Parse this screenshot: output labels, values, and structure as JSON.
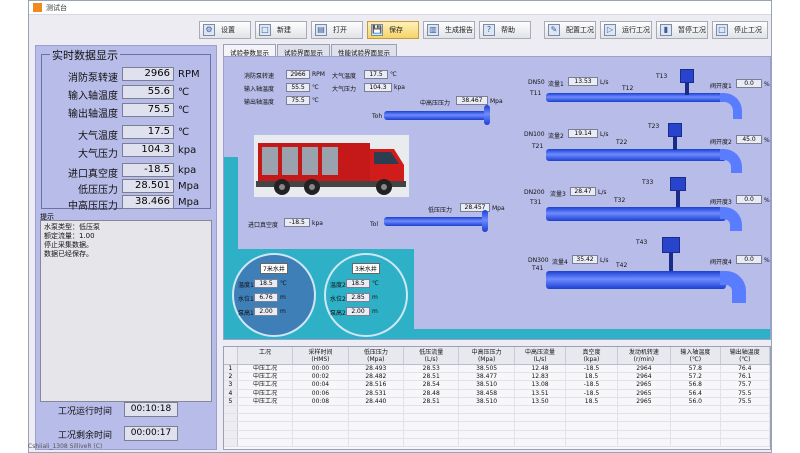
{
  "window": {
    "title": "测试台"
  },
  "toolbar": [
    {
      "id": "settings",
      "label": "设置",
      "icon": "⚙"
    },
    {
      "id": "new",
      "label": "新建",
      "icon": "□"
    },
    {
      "id": "open",
      "label": "打开",
      "icon": "▤"
    },
    {
      "id": "save",
      "label": "保存",
      "icon": "💾"
    },
    {
      "id": "report",
      "label": "生成报告",
      "icon": "▥"
    },
    {
      "id": "help",
      "label": "帮助",
      "icon": "?"
    },
    {
      "id": "config",
      "label": "配置工况",
      "icon": "✎"
    },
    {
      "id": "run",
      "label": "运行工况",
      "icon": "▷"
    },
    {
      "id": "pause",
      "label": "暂停工况",
      "icon": "▮"
    },
    {
      "id": "stop",
      "label": "停止工况",
      "icon": "□"
    }
  ],
  "left": {
    "group_title": "实时数据显示",
    "metrics": [
      {
        "label": "消防泵转速",
        "value": "2966",
        "unit": "RPM"
      },
      {
        "label": "输入轴温度",
        "value": "55.6",
        "unit": "℃"
      },
      {
        "label": "输出轴温度",
        "value": "75.5",
        "unit": "℃"
      },
      {
        "label": "大气温度",
        "value": "17.5",
        "unit": "℃"
      },
      {
        "label": "大气压力",
        "value": "104.3",
        "unit": "kpa"
      },
      {
        "label": "进口真空度",
        "value": "-18.5",
        "unit": "kpa"
      },
      {
        "label": "低压压力",
        "value": "28.501",
        "unit": "Mpa"
      },
      {
        "label": "中高压压力",
        "value": "38.466",
        "unit": "Mpa"
      }
    ],
    "tip_label": "提示",
    "tips": [
      "水泵类型：低压泵",
      "额定流量：1.00",
      "停止采集数据。",
      "数据已经保存。"
    ],
    "run_time_label": "工况运行时间",
    "run_time": "00:10:18",
    "remain_time_label": "工况剩余时间",
    "remain_time": "00:00:17"
  },
  "tabs": [
    "试验参数显示",
    "试验界面显示",
    "性能试验界面显示"
  ],
  "panel": {
    "small": [
      {
        "label": "消防泵转速",
        "value": "2966",
        "unit": "RPM"
      },
      {
        "label": "输入轴温度",
        "value": "55.5",
        "unit": "℃"
      },
      {
        "label": "输出轴温度",
        "value": "75.5",
        "unit": "℃"
      },
      {
        "label": "大气温度",
        "value": "17.5",
        "unit": "℃"
      },
      {
        "label": "大气压力",
        "value": "104.3",
        "unit": "kpa"
      }
    ],
    "mid_pressure": {
      "label": "中高压压力",
      "value": "38.467",
      "unit": "Mpa"
    },
    "low_pressure": {
      "label": "低压压力",
      "value": "28.457",
      "unit": "Mpa"
    },
    "inlet_vacuum": {
      "label": "进口真空度",
      "value": "-18.5",
      "unit": "kpa"
    },
    "toh": "Toh",
    "tol": "Tol",
    "lines": [
      {
        "dn": "DN50",
        "flow_label": "流量1",
        "flow": "13.53",
        "flow_unit": "L/s",
        "t_left": "T11",
        "t_mid": "T12",
        "t_top": "T13",
        "open_label": "阀开度1",
        "open": "0.0",
        "open_unit": "%"
      },
      {
        "dn": "DN100",
        "flow_label": "流量2",
        "flow": "19.14",
        "flow_unit": "L/s",
        "t_left": "T21",
        "t_mid": "T22",
        "t_top": "T23",
        "open_label": "阀开度2",
        "open": "45.0",
        "open_unit": "%"
      },
      {
        "dn": "DN200",
        "flow_label": "流量3",
        "flow": "28.47",
        "flow_unit": "L/s",
        "t_left": "T31",
        "t_mid": "T32",
        "t_top": "T33",
        "open_label": "阀开度3",
        "open": "0.0",
        "open_unit": "%"
      },
      {
        "dn": "DN300",
        "flow_label": "流量4",
        "flow": "35.42",
        "flow_unit": "L/s",
        "t_left": "T41",
        "t_mid": "T42",
        "t_top": "T43",
        "open_label": "阀开度4",
        "open": "0.0",
        "open_unit": "%"
      }
    ],
    "wells": [
      {
        "title": "7米水井",
        "rows": [
          {
            "label": "温度1",
            "value": "18.5",
            "unit": "℃"
          },
          {
            "label": "水位1",
            "value": "6.76",
            "unit": "m"
          },
          {
            "label": "泵高1",
            "value": "2.00",
            "unit": "m"
          }
        ]
      },
      {
        "title": "3米水井",
        "rows": [
          {
            "label": "温度2",
            "value": "18.5",
            "unit": "℃"
          },
          {
            "label": "水位2",
            "value": "2.85",
            "unit": "m"
          },
          {
            "label": "泵高2",
            "value": "2.00",
            "unit": "m"
          }
        ]
      }
    ]
  },
  "table": {
    "headers": [
      "工况",
      "采样时间\n(HMS)",
      "低压压力\n(Mpa)",
      "低压流量\n(L/s)",
      "中高压压力\n(Mpa)",
      "中高压流量\n(L/s)",
      "真空度\n(kpa)",
      "发动机转速\n(r/min)",
      "输入轴温度\n(℃)",
      "输出轴温度\n(℃)"
    ],
    "rows": [
      [
        "中压工况",
        "00:00",
        "28.493",
        "28.53",
        "38.505",
        "12.48",
        "-18.5",
        "2964",
        "57.8",
        "76.4"
      ],
      [
        "中压工况",
        "00:02",
        "28.482",
        "28.51",
        "38.477",
        "12.83",
        "18.5",
        "2964",
        "57.2",
        "76.1"
      ],
      [
        "中压工况",
        "00:04",
        "28.516",
        "28.54",
        "38.510",
        "13.08",
        "-18.5",
        "2965",
        "56.8",
        "75.7"
      ],
      [
        "中压工况",
        "00:06",
        "28.531",
        "28.48",
        "38.458",
        "13.51",
        "-18.5",
        "2965",
        "56.4",
        "75.5"
      ],
      [
        "中压工况",
        "00:08",
        "28.440",
        "28.51",
        "38.510",
        "13.50",
        "18.5",
        "2965",
        "56.0",
        "75.5"
      ]
    ]
  },
  "taskbar": "Cshiiali_1308 SilliveR (C)"
}
